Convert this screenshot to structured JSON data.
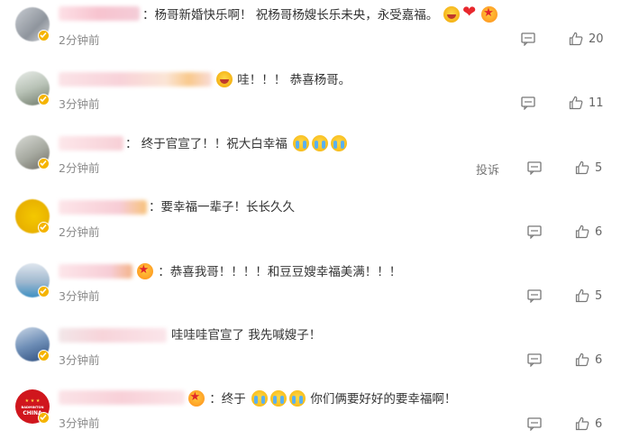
{
  "comments": [
    {
      "text": "：杨哥新婚快乐啊！ 祝杨哥杨嫂长乐未央，永受嘉福。",
      "emojis": [
        "haha",
        "heart",
        "star"
      ],
      "time": "2分钟前",
      "likes": "20",
      "show_report": false,
      "report": ""
    },
    {
      "text": "哇！！！ 恭喜杨哥。",
      "emojis": [],
      "time": "3分钟前",
      "likes": "11",
      "show_report": false,
      "report": ""
    },
    {
      "text": "： 终于官宣了！！祝大白幸福",
      "emojis": [
        "cry",
        "cry",
        "cry"
      ],
      "time": "2分钟前",
      "likes": "5",
      "show_report": true,
      "report": "投诉"
    },
    {
      "text": "：要幸福一辈子！长长久久",
      "emojis": [],
      "time": "2分钟前",
      "likes": "6",
      "show_report": false,
      "report": ""
    },
    {
      "text": "：恭喜我哥！！！！和豆豆嫂幸福美满！！！",
      "emojis": [],
      "time": "3分钟前",
      "likes": "5",
      "show_report": false,
      "report": ""
    },
    {
      "text": "哇哇哇官宣了 我先喊嫂子！",
      "emojis": [],
      "time": "3分钟前",
      "likes": "6",
      "show_report": false,
      "report": ""
    },
    {
      "text_before": "：终于",
      "text_after": "你们俩要好好的要幸福啊！",
      "emojis": [
        "cry",
        "cry",
        "cry"
      ],
      "time": "3分钟前",
      "likes": "6",
      "show_report": false,
      "report": "",
      "avatar_text": "BADMINTON CHINA"
    }
  ],
  "icons": {
    "reply": "comment-icon",
    "like": "thumbs-up-icon",
    "verified": "verified-badge-icon"
  },
  "colors": {
    "verified": "#f5b400",
    "text": "#333333",
    "meta": "#8a8a8a"
  }
}
